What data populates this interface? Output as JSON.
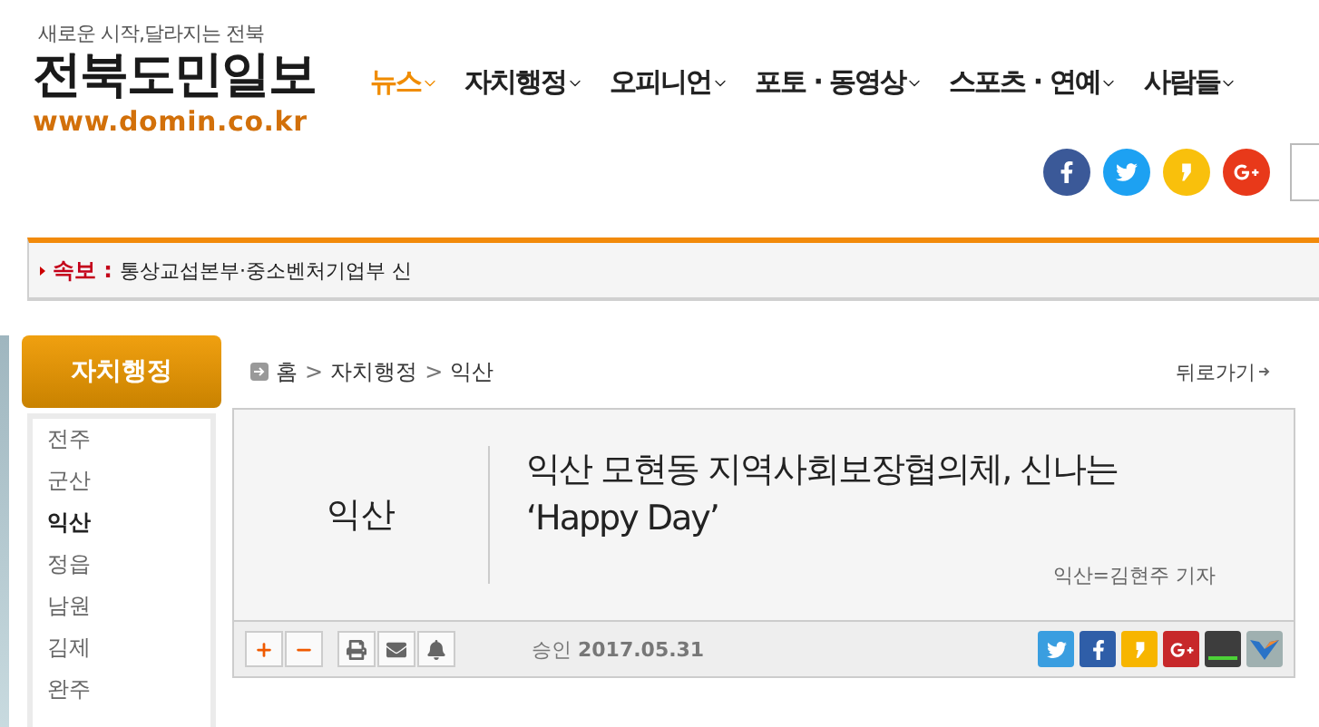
{
  "header": {
    "tagline": "새로운 시작,달라지는 전북",
    "logo": "전북도민일보",
    "url": "www.domin.co.kr"
  },
  "nav": [
    {
      "label": "뉴스",
      "selected": true
    },
    {
      "label": "자치행정",
      "selected": false
    },
    {
      "label": "오피니언",
      "selected": false
    },
    {
      "label": "포토 · 동영상",
      "selected": false
    },
    {
      "label": "스포츠 · 연예",
      "selected": false
    },
    {
      "label": "사람들",
      "selected": false
    }
  ],
  "social": [
    {
      "kind": "facebook",
      "color": "#3b5998"
    },
    {
      "kind": "twitter",
      "color": "#1da1f2"
    },
    {
      "kind": "kakao",
      "color": "#f9c00c"
    },
    {
      "kind": "google",
      "color": "#e8391a"
    }
  ],
  "breaking": {
    "label": "속보 :",
    "text": "통상교섭본부·중소벤처기업부 신"
  },
  "sidebar": {
    "title": "자치행정",
    "items": [
      {
        "label": "전주",
        "selected": false
      },
      {
        "label": "군산",
        "selected": false
      },
      {
        "label": "익산",
        "selected": true
      },
      {
        "label": "정읍",
        "selected": false
      },
      {
        "label": "남원",
        "selected": false
      },
      {
        "label": "김제",
        "selected": false
      },
      {
        "label": "완주",
        "selected": false
      }
    ]
  },
  "breadcrumb": {
    "items": [
      "홈",
      "자치행정",
      "익산"
    ],
    "separator": ">",
    "back": "뒤로가기"
  },
  "article": {
    "section": "익산",
    "title": "익산 모현동 지역사회보장협의체, 신나는 ‘Happy Day’",
    "byline": "익산=김현주 기자",
    "approved": "승인 **2017.05.31**",
    "font_buttons": [
      {
        "kind": "plus"
      },
      {
        "kind": "minus"
      }
    ],
    "tools": [
      {
        "kind": "print"
      },
      {
        "kind": "email"
      },
      {
        "kind": "alarm"
      }
    ],
    "share": [
      {
        "kind": "twitter",
        "color": "#3a9ee0"
      },
      {
        "kind": "facebook",
        "color": "#2f5ea8"
      },
      {
        "kind": "kakao",
        "color": "#f7b500"
      },
      {
        "kind": "google",
        "color": "#c7282a"
      },
      {
        "kind": "band",
        "color": "#3d3d3d"
      },
      {
        "kind": "bookmark",
        "color": "#9fb0b0"
      }
    ]
  }
}
